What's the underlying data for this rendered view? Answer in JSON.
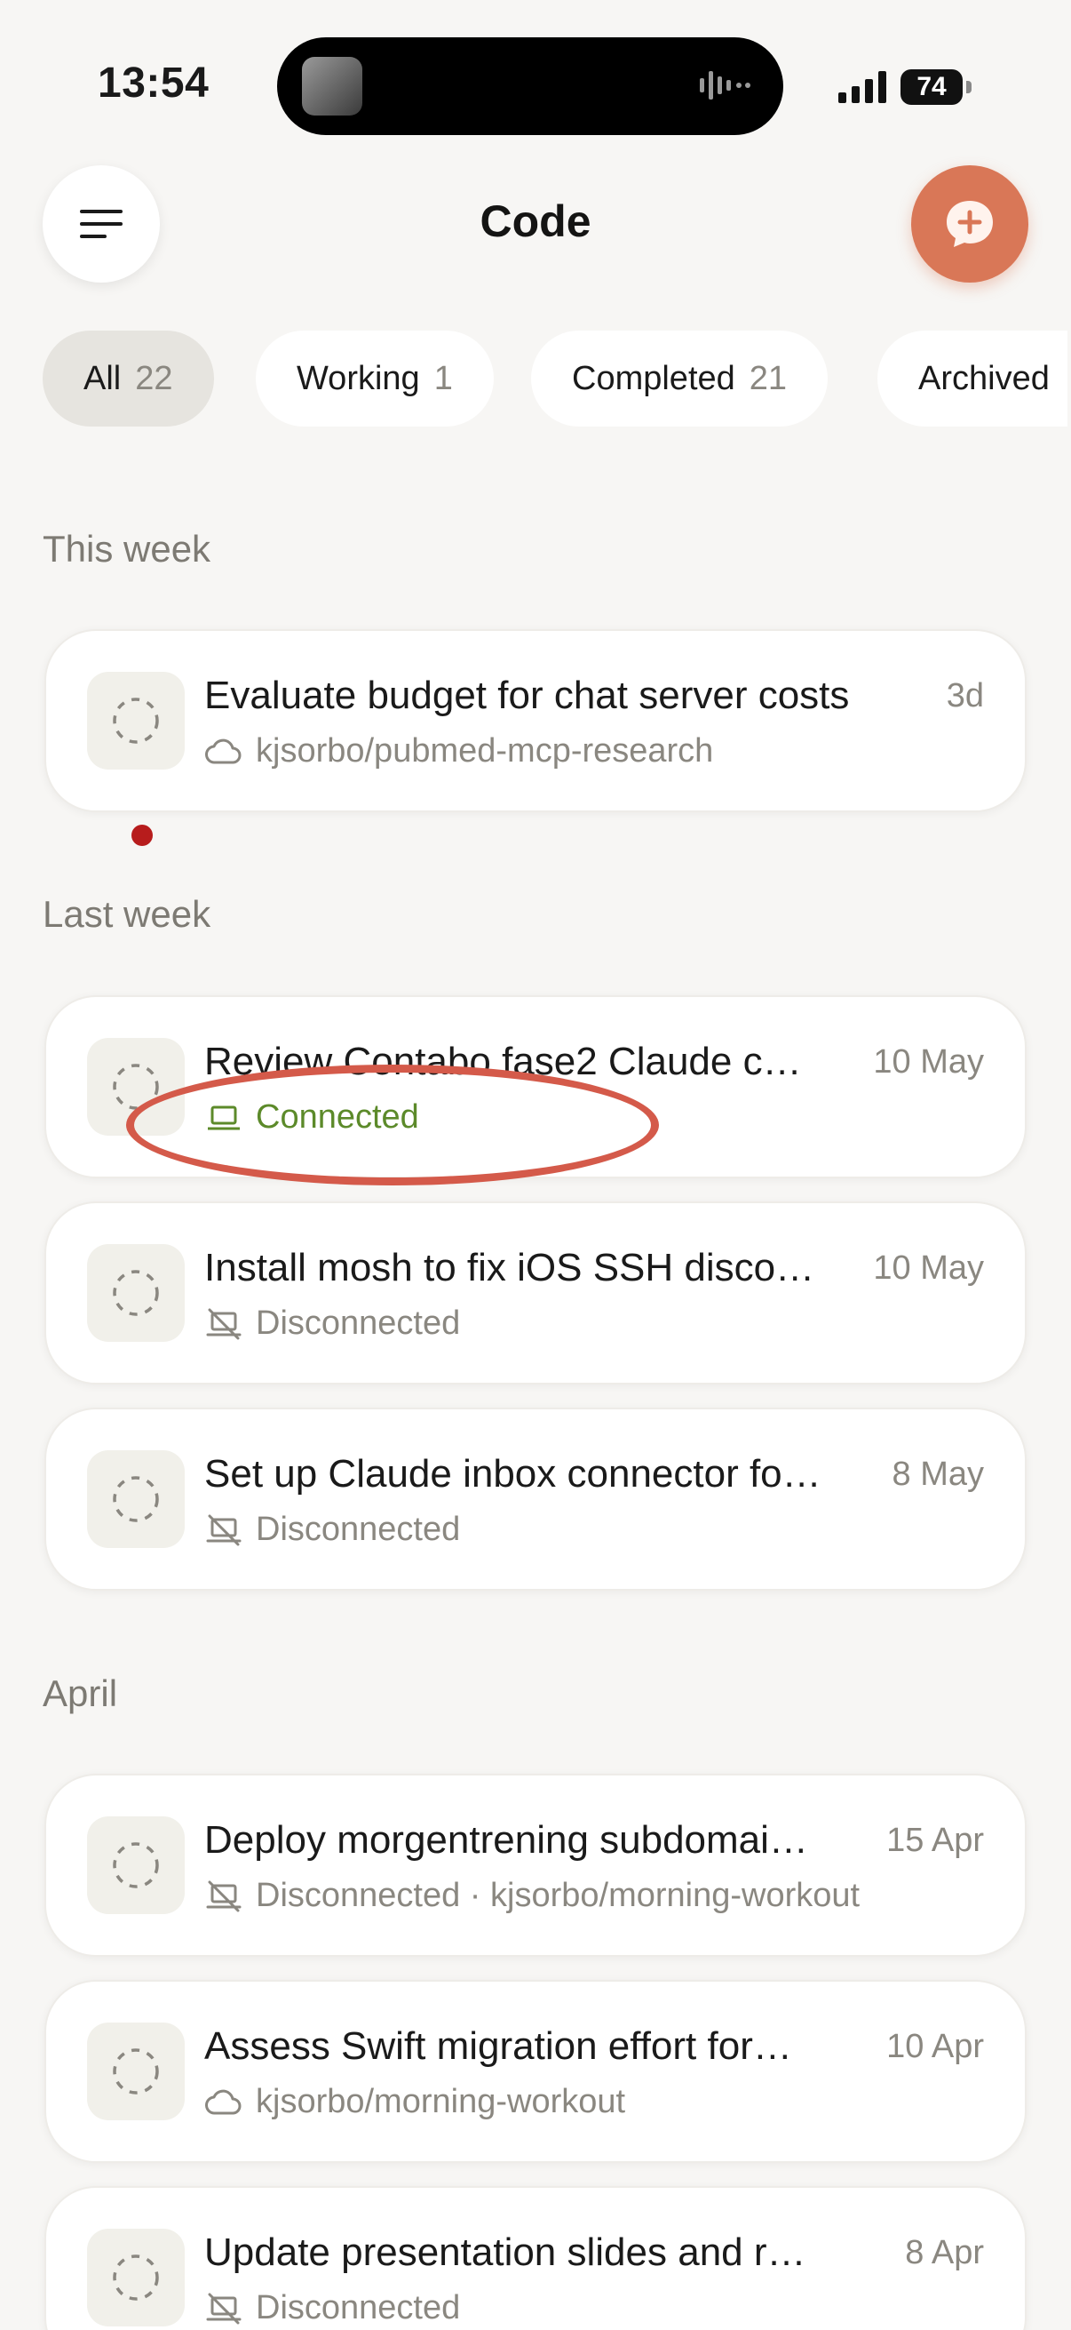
{
  "status_bar": {
    "time": "13:54",
    "battery": "74"
  },
  "header": {
    "title": "Code",
    "menu_icon": "menu-icon",
    "new_icon": "new-chat-plus-icon"
  },
  "filters": [
    {
      "label": "All",
      "count": "22",
      "active": true
    },
    {
      "label": "Working",
      "count": "1",
      "active": false
    },
    {
      "label": "Completed",
      "count": "21",
      "active": false
    },
    {
      "label": "Archived",
      "count": "",
      "active": false
    }
  ],
  "sections": {
    "this_week": "This week",
    "last_week": "Last week",
    "april": "April"
  },
  "sessions": [
    {
      "title": "Evaluate budget for chat server costs",
      "date": "3d",
      "sub_icon": "cloud-icon",
      "sub": "kjsorbo/pubmed-mcp-research"
    },
    {
      "title": "Review Contabo fase2 Claude c…",
      "date": "10 May",
      "sub_icon": "laptop-icon",
      "sub": "Connected"
    },
    {
      "title": "Install mosh to fix iOS SSH disco…",
      "date": "10 May",
      "sub_icon": "laptop-off-icon",
      "sub": "Disconnected"
    },
    {
      "title": "Set up Claude inbox connector fo…",
      "date": "8 May",
      "sub_icon": "laptop-off-icon",
      "sub": "Disconnected"
    },
    {
      "title": "Deploy morgentrening subdomai…",
      "date": "15 Apr",
      "sub_icon": "laptop-off-icon",
      "sub": "Disconnected · kjsorbo/morning-workout"
    },
    {
      "title": "Assess Swift migration effort for…",
      "date": "10 Apr",
      "sub_icon": "cloud-icon",
      "sub": "kjsorbo/morning-workout"
    },
    {
      "title": "Update presentation slides and r…",
      "date": "8 Apr",
      "sub_icon": "laptop-off-icon",
      "sub": "Disconnected"
    }
  ],
  "colors": {
    "accent": "#d97757",
    "connected": "#5c8a2a",
    "annotation": "#d45a4a"
  }
}
